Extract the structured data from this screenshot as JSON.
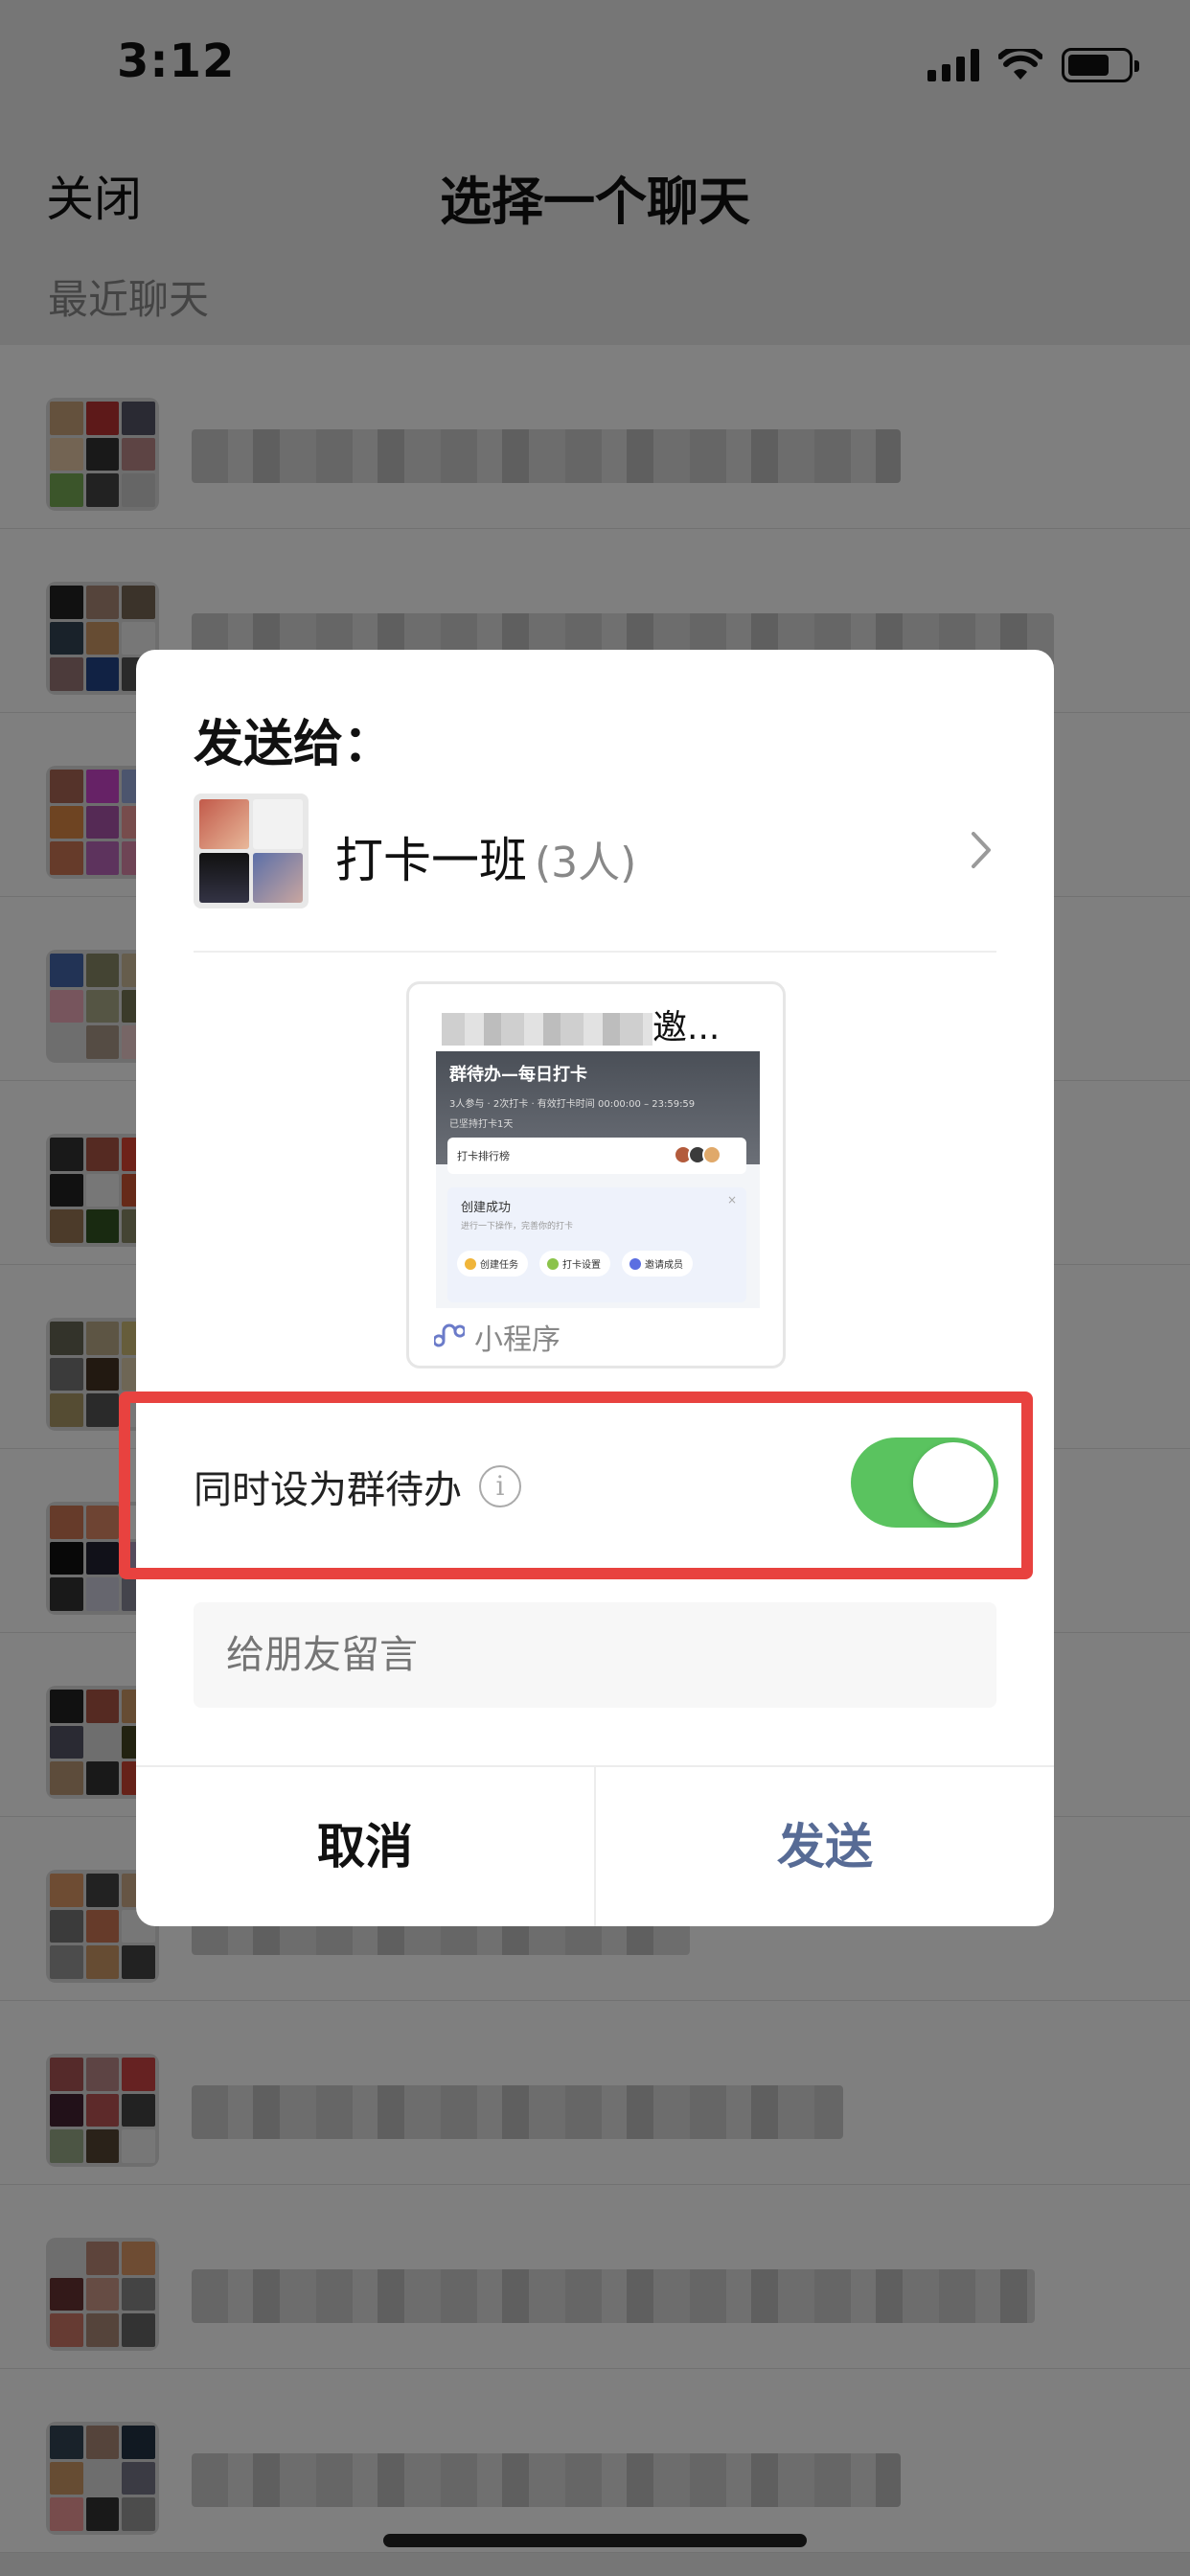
{
  "status_bar": {
    "time": "3:12"
  },
  "nav": {
    "close_label": "关闭",
    "title": "选择一个聊天"
  },
  "section_header": "最近聊天",
  "dialog": {
    "title": "发送给：",
    "recipient": {
      "name": "打卡一班",
      "member_count": "(3人)"
    },
    "card": {
      "title_suffix": "邀...",
      "screenshot": {
        "app_title": "群待办—每日打卡",
        "stats": "3人参与 · 2次打卡 · 有效打卡时间 00:00:00 – 23:59:59",
        "streak": "已坚持打卡1天",
        "rank_label": "打卡排行榜",
        "box_title": "创建成功",
        "box_sub": "进行一下操作，完善你的打卡",
        "pill_1": "创建任务",
        "pill_2": "打卡设置",
        "pill_3": "邀请成员",
        "close_x": "×"
      },
      "footer_label": "小程序"
    },
    "todo_option": {
      "label": "同时设为群待办",
      "info_icon_text": "i",
      "enabled": true
    },
    "message_placeholder": "给朋友留言",
    "cancel_label": "取消",
    "send_label": "发送"
  },
  "colors": {
    "toggle_on": "#5ac35f",
    "highlight": "#e8423f",
    "send_text": "#576b95"
  },
  "icons": [
    "signal-icon",
    "wifi-icon",
    "battery-icon",
    "chevron-right-icon",
    "info-icon",
    "mini-program-icon"
  ]
}
